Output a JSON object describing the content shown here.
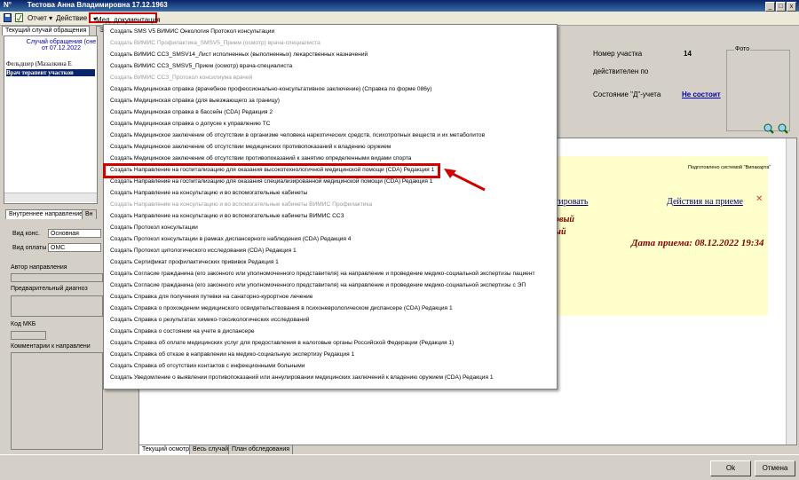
{
  "window": {
    "title_prefix": "N°",
    "title": "Тестова Анна Владимировна 17.12.1963",
    "btn_min": "_",
    "btn_max": "□",
    "btn_close": "x"
  },
  "toolbar": {
    "report": "Отчет",
    "action": "Действие",
    "med_docs": "Мед. документация"
  },
  "tabs_top": [
    "Текущий случай обращения",
    "Э"
  ],
  "left": {
    "case_line1": "Случай обращения (сне",
    "case_line2": "от 07.12.2022",
    "row1": "Фельдшер (Мазалкина Е",
    "row2": "Врач терапевт участков"
  },
  "lower_left": {
    "tab1": "Внутреннее направление",
    "tab2": "Вн",
    "cons_label": "Вид конс.",
    "cons_value": "Основная",
    "pay_label": "Вид оплаты",
    "pay_value": "ОМС",
    "author": "Автор направления",
    "diag": "Предварительный диагноз",
    "mkb": "Код МКБ",
    "comments": "Комментарии к направлени"
  },
  "right": {
    "area_label": "Номер участка",
    "area_value": "14",
    "valid_label": "действителен по",
    "d_label": "Состояние \"Д\"-учета",
    "d_value": "Не состоит",
    "photo": "Фото"
  },
  "content": {
    "prepared": "Подготовлено системой \"Випакарта\"",
    "tirovat": "тировать",
    "actions_link": "Действия на приеме",
    "close_x": "✕",
    "italic1": "овый",
    "italic2": "ый",
    "date_label": "Дата приема:",
    "date_value": "08.12.2022 19:34"
  },
  "bottom_tabs": [
    "Текущий осмотр",
    "Весь случай",
    "План обследования"
  ],
  "buttons": {
    "ok": "Ok",
    "cancel": "Отмена"
  },
  "menu": [
    {
      "label": "Создать SMS V5 ВИМИС Онкология Протокол консультации",
      "disabled": false
    },
    {
      "label": "Создать ВИМИС Профилактика_SMSV5_Прием (осмотр) врача-специалиста",
      "disabled": true
    },
    {
      "label": "Создать ВИМИС ССЗ_SMSV14_Лист исполненных (выполненных) лекарственных назначений",
      "disabled": false
    },
    {
      "label": "Создать ВИМИС ССЗ_SMSV5_Прием (осмотр) врача-специалиста",
      "disabled": false
    },
    {
      "label": "Создать ВИМИС ССЗ_Протокол консилиума врачей",
      "disabled": true
    },
    {
      "label": "Создать Медицинская справка (врачебное профессионально-консультативное заключение) (Справка по форме 086у)",
      "disabled": false
    },
    {
      "label": "Создать Медицинская справка (для выезжающего за границу)",
      "disabled": false
    },
    {
      "label": "Создать Медицинская справка в бассейн (CDA) Редакция 2",
      "disabled": false
    },
    {
      "label": "Создать Медицинская справка о допуске к управлению ТС",
      "disabled": false
    },
    {
      "label": "Создать Медицинское заключение об отсутствии в организме человека наркотических средств, психотропных веществ и их метаболитов",
      "disabled": false
    },
    {
      "label": "Создать Медицинское заключение об отсутствии медицинских противопоказаний к владению оружием",
      "disabled": false
    },
    {
      "label": "Создать Медицинское заключение об отсутствии противопоказаний к занятию определенными видами спорта",
      "disabled": false
    },
    {
      "label": "Создать Направление на госпитализацию для оказания высокотехнологичной медицинской помощи (CDA) Редакция 1",
      "disabled": false
    },
    {
      "label": "Создать Направление на госпитализацию для оказания специализированной медицинской помощи (CDA) Редакция 1",
      "disabled": false
    },
    {
      "label": "Создать Направление на консультацию и во вспомогательные кабинеты",
      "disabled": false
    },
    {
      "label": "Создать Направление на консультацию и во вспомогательные кабинеты ВИМИС Профилактика",
      "disabled": true
    },
    {
      "label": "Создать Направление на консультацию и во вспомогательные кабинеты ВИМИС ССЗ",
      "disabled": false
    },
    {
      "label": "Создать Протокол консультации",
      "disabled": false
    },
    {
      "label": "Создать Протокол консультации в рамках диспансерного наблюдения (CDA) Редакция 4",
      "disabled": false
    },
    {
      "label": "Создать Протокол цитологического исследования (CDA) Редакция 1",
      "disabled": false
    },
    {
      "label": "Создать Сертификат профилактических прививок Редакция 1",
      "disabled": false
    },
    {
      "label": "Создать Согласие гражданина (его законного или уполномоченного представителя) на направление и проведение медико-социальной экспертизы пациент",
      "disabled": false
    },
    {
      "label": "Создать Согласие гражданина (его законного или уполномоченного представителя) на направление и проведение медико-социальной экспертизы с ЭП",
      "disabled": false
    },
    {
      "label": "Создать Справка для получения путевки на санаторно-курортное лечение",
      "disabled": false
    },
    {
      "label": "Создать Справка о прохождении медицинского освидетельствования в психоневрологическом диспансере (CDA) Редакция 1",
      "disabled": false
    },
    {
      "label": "Создать Справка о результатах химико-токсикологических исследований",
      "disabled": false
    },
    {
      "label": "Создать Справка о состоянии на учете в диспансере",
      "disabled": false
    },
    {
      "label": "Создать Справка об оплате медицинских услуг для предоставления в налоговые органы Российской Федерации (Редакция 1)",
      "disabled": false
    },
    {
      "label": "Создать Справка об отказе в направлении на медико-социальную экспертизу Редакция 1",
      "disabled": false
    },
    {
      "label": "Создать Справка об отсутствии контактов с инфекционными больными",
      "disabled": false
    },
    {
      "label": "Создать Уведомление о выявлении противопоказаний или аннулировании медицинских заключений к владению оружием (CDA) Редакция 1",
      "disabled": false
    }
  ]
}
